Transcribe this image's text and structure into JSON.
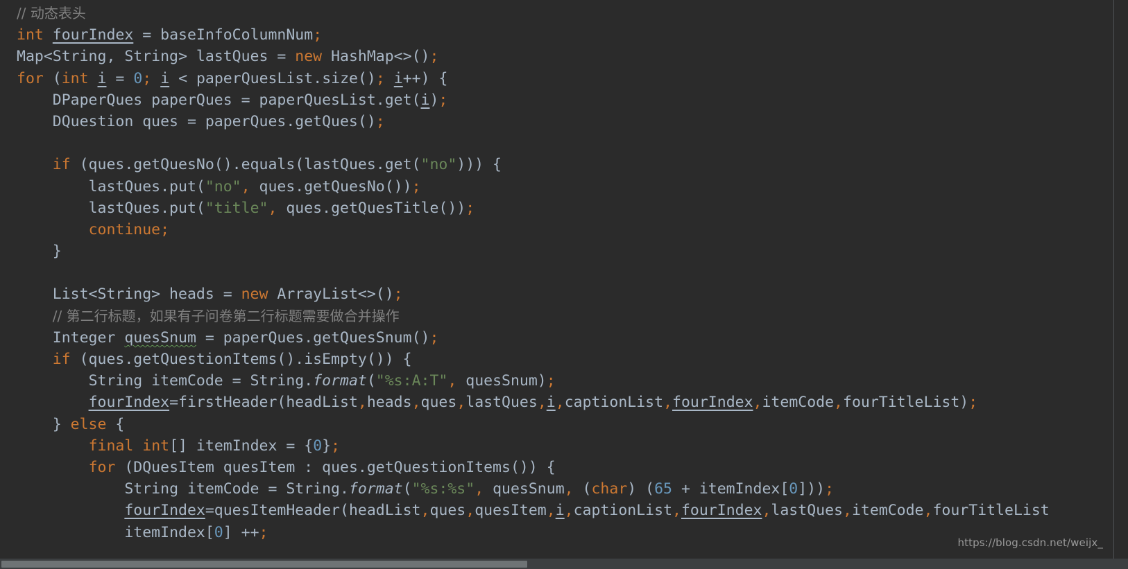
{
  "editor": {
    "language": "java",
    "theme": "darcula",
    "background_color": "#2b2b2b",
    "default_text_color": "#a9b7c6",
    "comment_color": "#808080",
    "keyword_color": "#cc7832",
    "string_color": "#6a8759",
    "number_color": "#6897bb",
    "warning_underline_color": "#629755"
  },
  "lines": [
    {
      "n": 1,
      "indent": 0,
      "tokens": [
        {
          "t": "cmt",
          "v": "// 动态表头"
        }
      ]
    },
    {
      "n": 2,
      "indent": 0,
      "tokens": [
        {
          "t": "kw",
          "v": "int"
        },
        {
          "t": "id",
          "v": " "
        },
        {
          "t": "fld",
          "v": "fourIndex"
        },
        {
          "t": "id",
          "v": " = baseInfoColumnNum"
        },
        {
          "t": "semi",
          "v": ";"
        }
      ]
    },
    {
      "n": 3,
      "indent": 0,
      "tokens": [
        {
          "t": "id",
          "v": "Map<String, String> lastQues = "
        },
        {
          "t": "kw",
          "v": "new"
        },
        {
          "t": "id",
          "v": " HashMap<>()"
        },
        {
          "t": "semi",
          "v": ";"
        }
      ]
    },
    {
      "n": 4,
      "indent": 0,
      "tokens": [
        {
          "t": "kw",
          "v": "for"
        },
        {
          "t": "id",
          "v": " ("
        },
        {
          "t": "kw",
          "v": "int"
        },
        {
          "t": "id",
          "v": " "
        },
        {
          "t": "fld",
          "v": "i"
        },
        {
          "t": "id",
          "v": " = "
        },
        {
          "t": "num",
          "v": "0"
        },
        {
          "t": "semi",
          "v": ";"
        },
        {
          "t": "id",
          "v": " "
        },
        {
          "t": "fld",
          "v": "i"
        },
        {
          "t": "id",
          "v": " < paperQuesList.size()"
        },
        {
          "t": "semi",
          "v": ";"
        },
        {
          "t": "id",
          "v": " "
        },
        {
          "t": "fld",
          "v": "i"
        },
        {
          "t": "id",
          "v": "++) {"
        }
      ]
    },
    {
      "n": 5,
      "indent": 1,
      "tokens": [
        {
          "t": "id",
          "v": "DPaperQues paperQues = paperQuesList.get("
        },
        {
          "t": "fld",
          "v": "i"
        },
        {
          "t": "id",
          "v": ")"
        },
        {
          "t": "semi",
          "v": ";"
        }
      ]
    },
    {
      "n": 6,
      "indent": 1,
      "tokens": [
        {
          "t": "id",
          "v": "DQuestion ques = paperQues.getQues()"
        },
        {
          "t": "semi",
          "v": ";"
        }
      ]
    },
    {
      "n": 7,
      "indent": 0,
      "tokens": []
    },
    {
      "n": 8,
      "indent": 1,
      "tokens": [
        {
          "t": "kw",
          "v": "if"
        },
        {
          "t": "id",
          "v": " (ques.getQuesNo().equals(lastQues.get("
        },
        {
          "t": "str",
          "v": "\"no\""
        },
        {
          "t": "id",
          "v": "))) {"
        }
      ]
    },
    {
      "n": 9,
      "indent": 2,
      "tokens": [
        {
          "t": "id",
          "v": "lastQues.put("
        },
        {
          "t": "str",
          "v": "\"no\""
        },
        {
          "t": "comma",
          "v": ","
        },
        {
          "t": "id",
          "v": " ques.getQuesNo())"
        },
        {
          "t": "semi",
          "v": ";"
        }
      ]
    },
    {
      "n": 10,
      "indent": 2,
      "tokens": [
        {
          "t": "id",
          "v": "lastQues.put("
        },
        {
          "t": "str",
          "v": "\"title\""
        },
        {
          "t": "comma",
          "v": ","
        },
        {
          "t": "id",
          "v": " ques.getQuesTitle())"
        },
        {
          "t": "semi",
          "v": ";"
        }
      ]
    },
    {
      "n": 11,
      "indent": 2,
      "tokens": [
        {
          "t": "kw",
          "v": "continue"
        },
        {
          "t": "semi",
          "v": ";"
        }
      ]
    },
    {
      "n": 12,
      "indent": 1,
      "tokens": [
        {
          "t": "id",
          "v": "}"
        }
      ]
    },
    {
      "n": 13,
      "indent": 0,
      "tokens": []
    },
    {
      "n": 14,
      "indent": 1,
      "tokens": [
        {
          "t": "id",
          "v": "List<String> heads = "
        },
        {
          "t": "kw",
          "v": "new"
        },
        {
          "t": "id",
          "v": " ArrayList<>()"
        },
        {
          "t": "semi",
          "v": ";"
        }
      ]
    },
    {
      "n": 15,
      "indent": 1,
      "tokens": [
        {
          "t": "cmt",
          "v": "// 第二行标题，如果有子问卷第二行标题需要做合并操作"
        }
      ]
    },
    {
      "n": 16,
      "indent": 1,
      "tokens": [
        {
          "t": "id",
          "v": "Integer "
        },
        {
          "t": "wavy",
          "v": "quesSnum"
        },
        {
          "t": "id",
          "v": " = paperQues.getQuesSnum()"
        },
        {
          "t": "semi",
          "v": ";"
        }
      ]
    },
    {
      "n": 17,
      "indent": 1,
      "tokens": [
        {
          "t": "kw",
          "v": "if"
        },
        {
          "t": "id",
          "v": " (ques.getQuestionItems().isEmpty()) {"
        }
      ]
    },
    {
      "n": 18,
      "indent": 2,
      "tokens": [
        {
          "t": "id",
          "v": "String itemCode = String."
        },
        {
          "t": "meth",
          "v": "format"
        },
        {
          "t": "id",
          "v": "("
        },
        {
          "t": "str",
          "v": "\"%s:A:T\""
        },
        {
          "t": "comma",
          "v": ","
        },
        {
          "t": "id",
          "v": " quesSnum)"
        },
        {
          "t": "semi",
          "v": ";"
        }
      ]
    },
    {
      "n": 19,
      "indent": 2,
      "tokens": [
        {
          "t": "fld",
          "v": "fourIndex"
        },
        {
          "t": "id",
          "v": "=firstHeader(headList"
        },
        {
          "t": "comma",
          "v": ","
        },
        {
          "t": "id",
          "v": "heads"
        },
        {
          "t": "comma",
          "v": ","
        },
        {
          "t": "id",
          "v": "ques"
        },
        {
          "t": "comma",
          "v": ","
        },
        {
          "t": "id",
          "v": "lastQues"
        },
        {
          "t": "comma",
          "v": ","
        },
        {
          "t": "fld",
          "v": "i"
        },
        {
          "t": "comma",
          "v": ","
        },
        {
          "t": "id",
          "v": "captionList"
        },
        {
          "t": "comma",
          "v": ","
        },
        {
          "t": "fld",
          "v": "fourIndex"
        },
        {
          "t": "comma",
          "v": ","
        },
        {
          "t": "id",
          "v": "itemCode"
        },
        {
          "t": "comma",
          "v": ","
        },
        {
          "t": "id",
          "v": "fourTitleList)"
        },
        {
          "t": "semi",
          "v": ";"
        }
      ]
    },
    {
      "n": 20,
      "indent": 1,
      "tokens": [
        {
          "t": "id",
          "v": "} "
        },
        {
          "t": "kw",
          "v": "else"
        },
        {
          "t": "id",
          "v": " {"
        }
      ]
    },
    {
      "n": 21,
      "indent": 2,
      "tokens": [
        {
          "t": "kw",
          "v": "final"
        },
        {
          "t": "id",
          "v": " "
        },
        {
          "t": "kw",
          "v": "int"
        },
        {
          "t": "id",
          "v": "[] itemIndex = {"
        },
        {
          "t": "num",
          "v": "0"
        },
        {
          "t": "id",
          "v": "}"
        },
        {
          "t": "semi",
          "v": ";"
        }
      ]
    },
    {
      "n": 22,
      "indent": 2,
      "tokens": [
        {
          "t": "kw",
          "v": "for"
        },
        {
          "t": "id",
          "v": " (DQuesItem quesItem : ques.getQuestionItems()) {"
        }
      ]
    },
    {
      "n": 23,
      "indent": 3,
      "tokens": [
        {
          "t": "id",
          "v": "String itemCode = String."
        },
        {
          "t": "meth",
          "v": "format"
        },
        {
          "t": "id",
          "v": "("
        },
        {
          "t": "str",
          "v": "\"%s:%s\""
        },
        {
          "t": "comma",
          "v": ","
        },
        {
          "t": "id",
          "v": " quesSnum"
        },
        {
          "t": "comma",
          "v": ","
        },
        {
          "t": "id",
          "v": " ("
        },
        {
          "t": "kw",
          "v": "char"
        },
        {
          "t": "id",
          "v": ") ("
        },
        {
          "t": "num",
          "v": "65"
        },
        {
          "t": "id",
          "v": " + itemIndex["
        },
        {
          "t": "num",
          "v": "0"
        },
        {
          "t": "id",
          "v": "]))"
        },
        {
          "t": "semi",
          "v": ";"
        }
      ]
    },
    {
      "n": 24,
      "indent": 3,
      "tokens": [
        {
          "t": "fld",
          "v": "fourIndex"
        },
        {
          "t": "id",
          "v": "=quesItemHeader(headList"
        },
        {
          "t": "comma",
          "v": ","
        },
        {
          "t": "id",
          "v": "ques"
        },
        {
          "t": "comma",
          "v": ","
        },
        {
          "t": "id",
          "v": "quesItem"
        },
        {
          "t": "comma",
          "v": ","
        },
        {
          "t": "fld",
          "v": "i"
        },
        {
          "t": "comma",
          "v": ","
        },
        {
          "t": "id",
          "v": "captionList"
        },
        {
          "t": "comma",
          "v": ","
        },
        {
          "t": "fld",
          "v": "fourIndex"
        },
        {
          "t": "comma",
          "v": ","
        },
        {
          "t": "id",
          "v": "lastQues"
        },
        {
          "t": "comma",
          "v": ","
        },
        {
          "t": "id",
          "v": "itemCode"
        },
        {
          "t": "comma",
          "v": ","
        },
        {
          "t": "id",
          "v": "fourTitleList"
        }
      ]
    },
    {
      "n": 25,
      "indent": 3,
      "tokens": [
        {
          "t": "id",
          "v": "itemIndex["
        },
        {
          "t": "num",
          "v": "0"
        },
        {
          "t": "id",
          "v": "] ++"
        },
        {
          "t": "semi",
          "v": ";"
        }
      ]
    }
  ],
  "watermark": {
    "text": "https://blog.csdn.net/weijx_"
  },
  "scrollbars": {
    "horizontal_visible": true,
    "vertical_visible": true
  }
}
